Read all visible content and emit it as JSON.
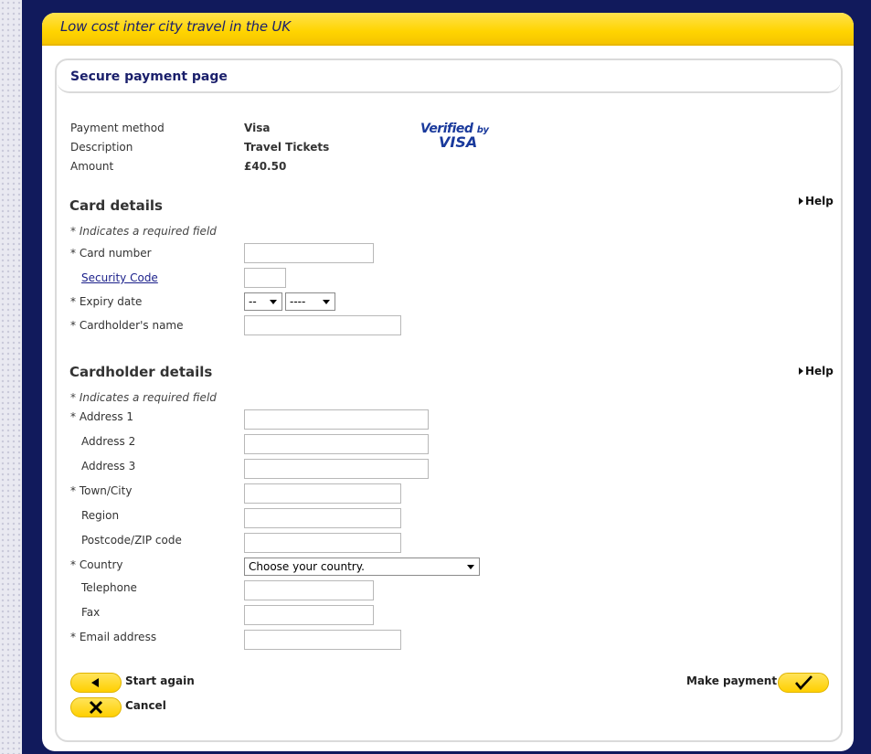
{
  "banner": {
    "title": "Low cost inter city travel in the UK"
  },
  "page": {
    "title": "Secure payment page"
  },
  "summary": {
    "method_label": "Payment method",
    "method_value": "Visa",
    "desc_label": "Description",
    "desc_value": "Travel Tickets",
    "amount_label": "Amount",
    "amount_value": "£40.50"
  },
  "logo": {
    "line1": "Verified",
    "by": "by",
    "line2": "VISA"
  },
  "card": {
    "title": "Card details",
    "help": "Help",
    "required_note": "* Indicates a required field",
    "card_number": "* Card number",
    "security_code": "Security Code",
    "expiry_date": "* Expiry date",
    "expiry_month": "--",
    "expiry_year": "----",
    "cardholder_name": "* Cardholder's name"
  },
  "holder": {
    "title": "Cardholder details",
    "help": "Help",
    "required_note": "* Indicates a required field",
    "address1": "* Address 1",
    "address2": "Address 2",
    "address3": "Address 3",
    "town": "* Town/City",
    "region": "Region",
    "postcode": "Postcode/ZIP code",
    "country": "* Country",
    "country_value": "Choose your country.",
    "telephone": "Telephone",
    "fax": "Fax",
    "email": "* Email address"
  },
  "actions": {
    "start_again": "Start again",
    "cancel": "Cancel",
    "make_payment": "Make payment"
  },
  "colors": {
    "navy": "#111a5c",
    "yellow": "#ffd400",
    "text": "#333333"
  }
}
